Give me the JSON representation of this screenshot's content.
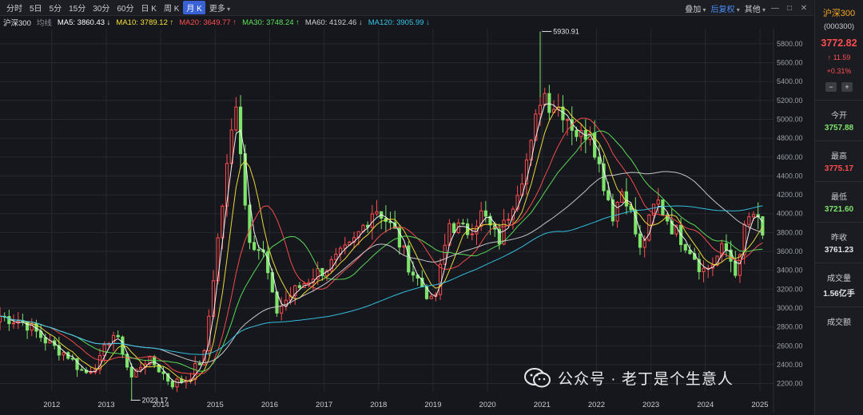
{
  "toolbar": {
    "periods": [
      "分时",
      "5日",
      "5分",
      "15分",
      "30分",
      "60分",
      "日 K",
      "周 K",
      "月 K",
      "更多"
    ],
    "active_period": "月 K",
    "overlay": "叠加",
    "adjust": "后复权",
    "others": "其他"
  },
  "ma_bar": {
    "index_name": "沪深300",
    "avg_label": "均线",
    "items": [
      {
        "text": "MA5: 3860.43 ↓",
        "color": "#ffffff"
      },
      {
        "text": "MA10: 3789.12 ↑",
        "color": "#f7e23a"
      },
      {
        "text": "MA20: 3649.77 ↑",
        "color": "#ff4d4f"
      },
      {
        "text": "MA30: 3748.24 ↑",
        "color": "#5ee35a"
      },
      {
        "text": "MA60: 4192.46 ↓",
        "color": "#cfcfcf"
      },
      {
        "text": "MA120: 3905.99 ↓",
        "color": "#35c6e8"
      }
    ]
  },
  "sidebar": {
    "name": "沪深300",
    "code": "(000300)",
    "price": "3772.82",
    "change": "↑ 11.59",
    "change_pct": "+0.31%",
    "stats": [
      {
        "label": "今开",
        "value": "3757.88",
        "color": "#7ee36b"
      },
      {
        "label": "最高",
        "value": "3775.17",
        "color": "#ff4d4f"
      },
      {
        "label": "最低",
        "value": "3721.60",
        "color": "#7ee36b"
      },
      {
        "label": "昨收",
        "value": "3761.23",
        "color": "#e0e3e8"
      },
      {
        "label": "成交量",
        "value": "1.56亿手",
        "color": "#e0e3e8"
      },
      {
        "label": "成交额",
        "value": "",
        "color": "#e0e3e8"
      }
    ]
  },
  "watermark": {
    "text": "公众号 · 老丁是个生意人"
  },
  "colors": {
    "up": "#ff4d4f",
    "down": "#7ee36b",
    "bg": "#15171c",
    "grid": "#262930"
  },
  "chart_data": {
    "type": "candlestick",
    "x_ticks": [
      "2012",
      "2013",
      "2014",
      "2015",
      "2016",
      "2017",
      "2018",
      "2019",
      "2020",
      "2021",
      "2022",
      "2023",
      "2024",
      "2025"
    ],
    "y_ticks": [
      2200,
      2400,
      2600,
      2800,
      3000,
      3200,
      3400,
      3600,
      3800,
      4000,
      4200,
      4400,
      4600,
      4800,
      5000,
      5200,
      5400,
      5600,
      5800
    ],
    "ylim": [
      2120,
      5960
    ],
    "annotations": [
      {
        "text": "5930.91",
        "value": 5930.91,
        "date": 2021.0
      },
      {
        "text": "2023.17",
        "value": 2023.17,
        "date": 2013.45
      }
    ],
    "ohlc_keypoints": {
      "description": "monthly close path keypoints (year, close)",
      "points": [
        [
          2011.0,
          2920
        ],
        [
          2011.5,
          2850
        ],
        [
          2012.0,
          2600
        ],
        [
          2012.3,
          2500
        ],
        [
          2012.6,
          2300
        ],
        [
          2012.9,
          2450
        ],
        [
          2013.1,
          2750
        ],
        [
          2013.3,
          2550
        ],
        [
          2013.45,
          2250
        ],
        [
          2013.7,
          2450
        ],
        [
          2013.9,
          2400
        ],
        [
          2014.2,
          2200
        ],
        [
          2014.5,
          2250
        ],
        [
          2014.8,
          2500
        ],
        [
          2015.0,
          3500
        ],
        [
          2015.2,
          4400
        ],
        [
          2015.4,
          5300
        ],
        [
          2015.5,
          4400
        ],
        [
          2015.6,
          3800
        ],
        [
          2015.9,
          3550
        ],
        [
          2016.1,
          2950
        ],
        [
          2016.4,
          3150
        ],
        [
          2016.8,
          3350
        ],
        [
          2017.1,
          3450
        ],
        [
          2017.5,
          3650
        ],
        [
          2017.9,
          4050
        ],
        [
          2018.0,
          4050
        ],
        [
          2018.3,
          3800
        ],
        [
          2018.6,
          3400
        ],
        [
          2018.9,
          3150
        ],
        [
          2019.0,
          3000
        ],
        [
          2019.3,
          3900
        ],
        [
          2019.6,
          3800
        ],
        [
          2019.9,
          4000
        ],
        [
          2020.2,
          3700
        ],
        [
          2020.5,
          4200
        ],
        [
          2020.8,
          4700
        ],
        [
          2021.0,
          5350
        ],
        [
          2021.1,
          5200
        ],
        [
          2021.4,
          5100
        ],
        [
          2021.7,
          4800
        ],
        [
          2021.9,
          4950
        ],
        [
          2022.0,
          4600
        ],
        [
          2022.3,
          4000
        ],
        [
          2022.5,
          4300
        ],
        [
          2022.8,
          3600
        ],
        [
          2022.95,
          3870
        ],
        [
          2023.1,
          4150
        ],
        [
          2023.4,
          3850
        ],
        [
          2023.7,
          3650
        ],
        [
          2023.95,
          3400
        ],
        [
          2024.1,
          3450
        ],
        [
          2024.35,
          3650
        ],
        [
          2024.6,
          3350
        ],
        [
          2024.75,
          4000
        ],
        [
          2024.9,
          3900
        ],
        [
          2025.0,
          3950
        ],
        [
          2025.1,
          3772
        ]
      ]
    },
    "ma_lines": [
      {
        "name": "MA5",
        "color": "#ffffff",
        "lag": 0.25
      },
      {
        "name": "MA10",
        "color": "#f7e23a",
        "lag": 0.5
      },
      {
        "name": "MA20",
        "color": "#ff4d4f",
        "lag": 1.0
      },
      {
        "name": "MA30",
        "color": "#5ee35a",
        "lag": 1.5
      },
      {
        "name": "MA60",
        "color": "#cfcfcf",
        "lag": 3.0
      },
      {
        "name": "MA120",
        "color": "#35c6e8",
        "lag": 6.0
      }
    ]
  }
}
